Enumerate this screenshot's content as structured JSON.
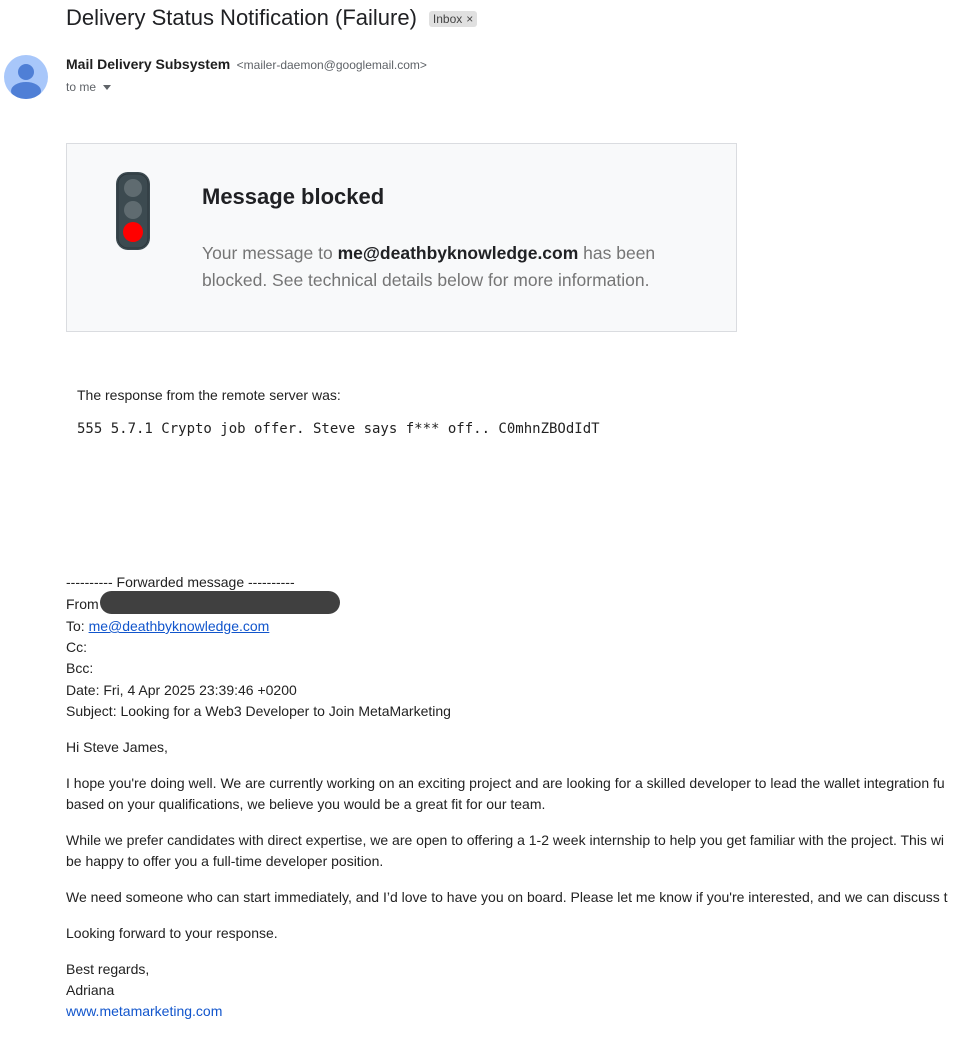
{
  "email": {
    "subject": "Delivery Status Notification (Failure)",
    "label_chip": "Inbox",
    "chip_close": "×",
    "sender_name": "Mail Delivery Subsystem",
    "sender_email": "<mailer-daemon@googlemail.com>",
    "recipient_text": "to me"
  },
  "notice": {
    "title": "Message blocked",
    "text_prefix": "Your message to ",
    "blocked_address": "me@deathbyknowledge.com",
    "text_suffix": " has been blocked. See technical details below for more information."
  },
  "response": {
    "label": "The response from the remote server was:",
    "code": "555 5.7.1 Crypto job offer. Steve says f*** off.. C0mhnZBOdIdT"
  },
  "forwarded": {
    "header": "---------- Forwarded message ----------",
    "from_label": "From",
    "to_label": "To: ",
    "to_address": "me@deathbyknowledge.com",
    "cc": "Cc:",
    "bcc": "Bcc:",
    "date": "Date: Fri, 4 Apr 2025 23:39:46 +0200",
    "subject": "Subject: Looking for a Web3 Developer to Join MetaMarketing"
  },
  "body": {
    "greeting": "Hi Steve James,",
    "p1_line1": "I hope you're doing well. We are currently working on an exciting project and are looking for a skilled developer to lead the wallet integration fu",
    "p1_line2": "based on your qualifications, we believe you would be a great fit for our team.",
    "p2_line1": "While we prefer candidates with direct expertise, we are open to offering a 1-2 week internship to help you get familiar with the project. This wi",
    "p2_line2": "be happy to offer you a full-time developer position.",
    "p3_line1": "We need someone who can start immediately, and I’d love to have you on board. Please let me know if you're interested, and we can discuss t",
    "closing1": "Looking forward to your response.",
    "signoff": "Best regards,",
    "signature_name": "Adriana",
    "website": "www.metamarketing.com"
  },
  "colors": {
    "light_red": "#ff0000",
    "light_off": "#5f6b70",
    "light_body": "#3c4a50",
    "link": "#1155cc"
  }
}
